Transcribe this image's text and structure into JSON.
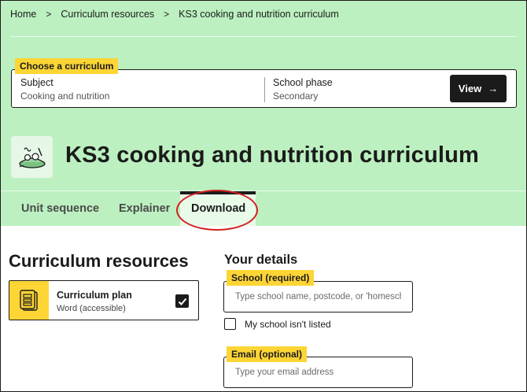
{
  "breadcrumb": {
    "items": [
      "Home",
      "Curriculum resources",
      "KS3 cooking and nutrition curriculum"
    ],
    "separator": ">"
  },
  "chooser": {
    "tag": "Choose a curriculum",
    "subject_label": "Subject",
    "subject_value": "Cooking and nutrition",
    "phase_label": "School phase",
    "phase_value": "Secondary",
    "view_label": "View",
    "view_icon": "→"
  },
  "page": {
    "title": "KS3 cooking and nutrition curriculum",
    "subject_icon": "cooking-nutrition-icon"
  },
  "tabs": [
    {
      "label": "Unit sequence"
    },
    {
      "label": "Explainer"
    },
    {
      "label": "Download",
      "active": true
    }
  ],
  "resources": {
    "heading": "Curriculum resources",
    "items": [
      {
        "title": "Curriculum plan",
        "subtitle": "Word (accessible)",
        "checked": true,
        "icon": "document-icon"
      }
    ]
  },
  "details": {
    "heading": "Your details",
    "school_tag": "School (required)",
    "school_placeholder": "Type school name, postcode, or 'homeschool'",
    "unlisted_label": "My school isn't listed",
    "email_tag": "Email (optional)",
    "email_placeholder": "Type your email address"
  },
  "colors": {
    "header_bg": "#bcf0c0",
    "highlight_yellow": "#fdd535",
    "dark": "#1b1b1b",
    "annotation_ring": "#d42020"
  }
}
